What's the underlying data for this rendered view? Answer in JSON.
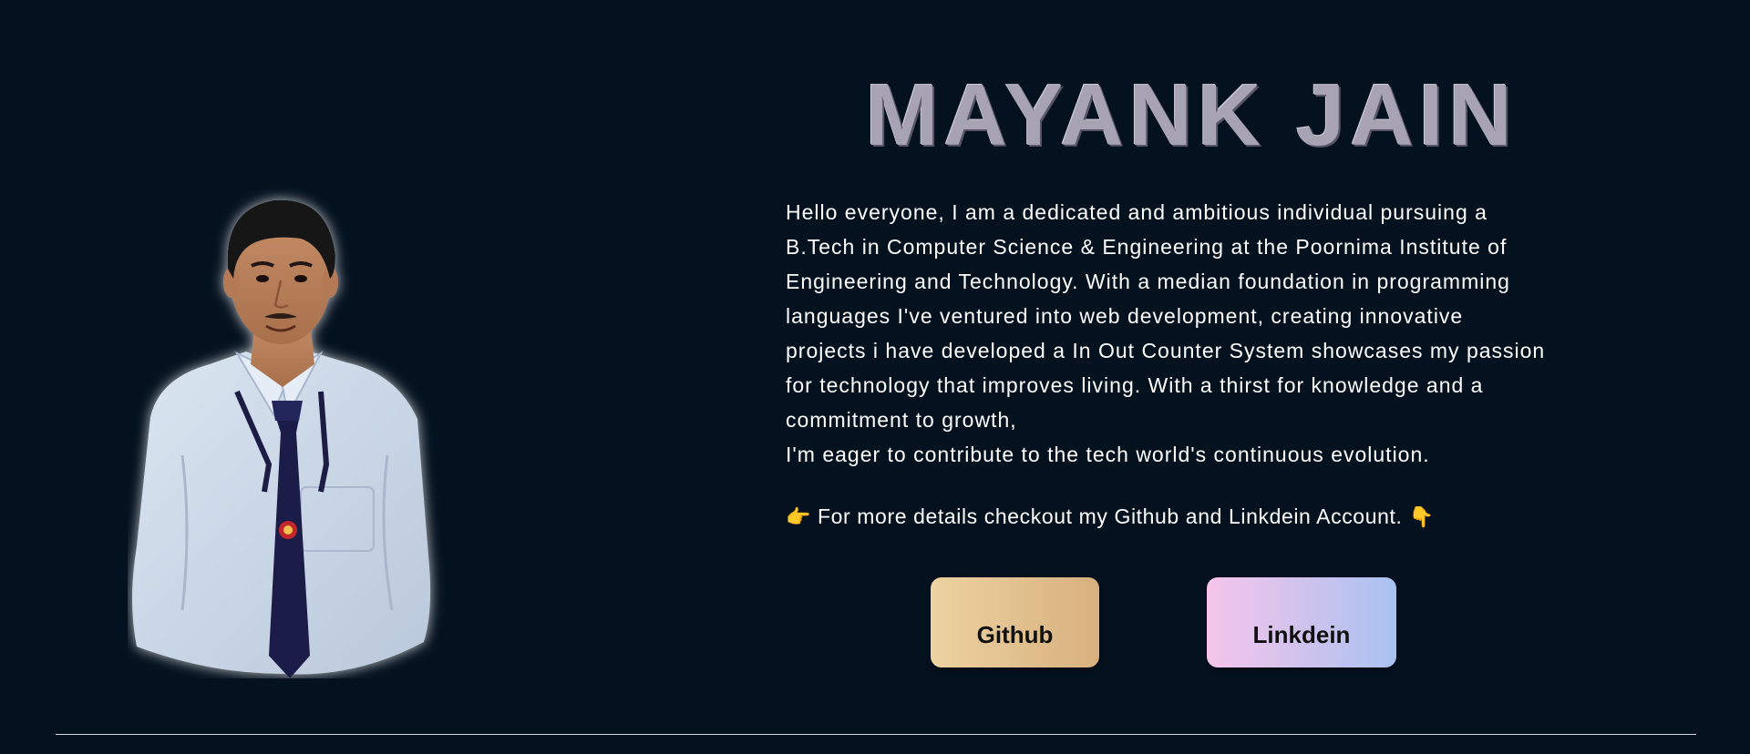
{
  "profile": {
    "name": "MAYANK JAIN",
    "photo_alt": "Portrait of Mayank Jain"
  },
  "about": {
    "lines": [
      "Hello everyone, I am a dedicated and ambitious individual pursuing a",
      "B.Tech in Computer Science & Engineering at the Poornima Institute of",
      "Engineering and Technology. With a median foundation in programming",
      "languages I've ventured into web development, creating innovative",
      "projects i have developed a In Out Counter System showcases my passion",
      "for technology that improves living. With a thirst for knowledge and a",
      "commitment to growth,",
      "I'm eager to contribute to the tech world's continuous evolution."
    ],
    "cta_text": "For more details checkout my Github and Linkdein Account.",
    "cta_icon_left": "👉",
    "cta_icon_right": "👇"
  },
  "buttons": {
    "github_label": "Github",
    "linkedin_label": "Linkdein"
  },
  "colors": {
    "background": "#04111f",
    "name_text": "#a7a3b2",
    "body_text": "#ffffff",
    "github_gradient": [
      "#ecd3a1",
      "#d8b07e"
    ],
    "linkedin_gradient": [
      "#f6c4ea",
      "#a9c2f0"
    ],
    "divider": "#d8dce2"
  }
}
